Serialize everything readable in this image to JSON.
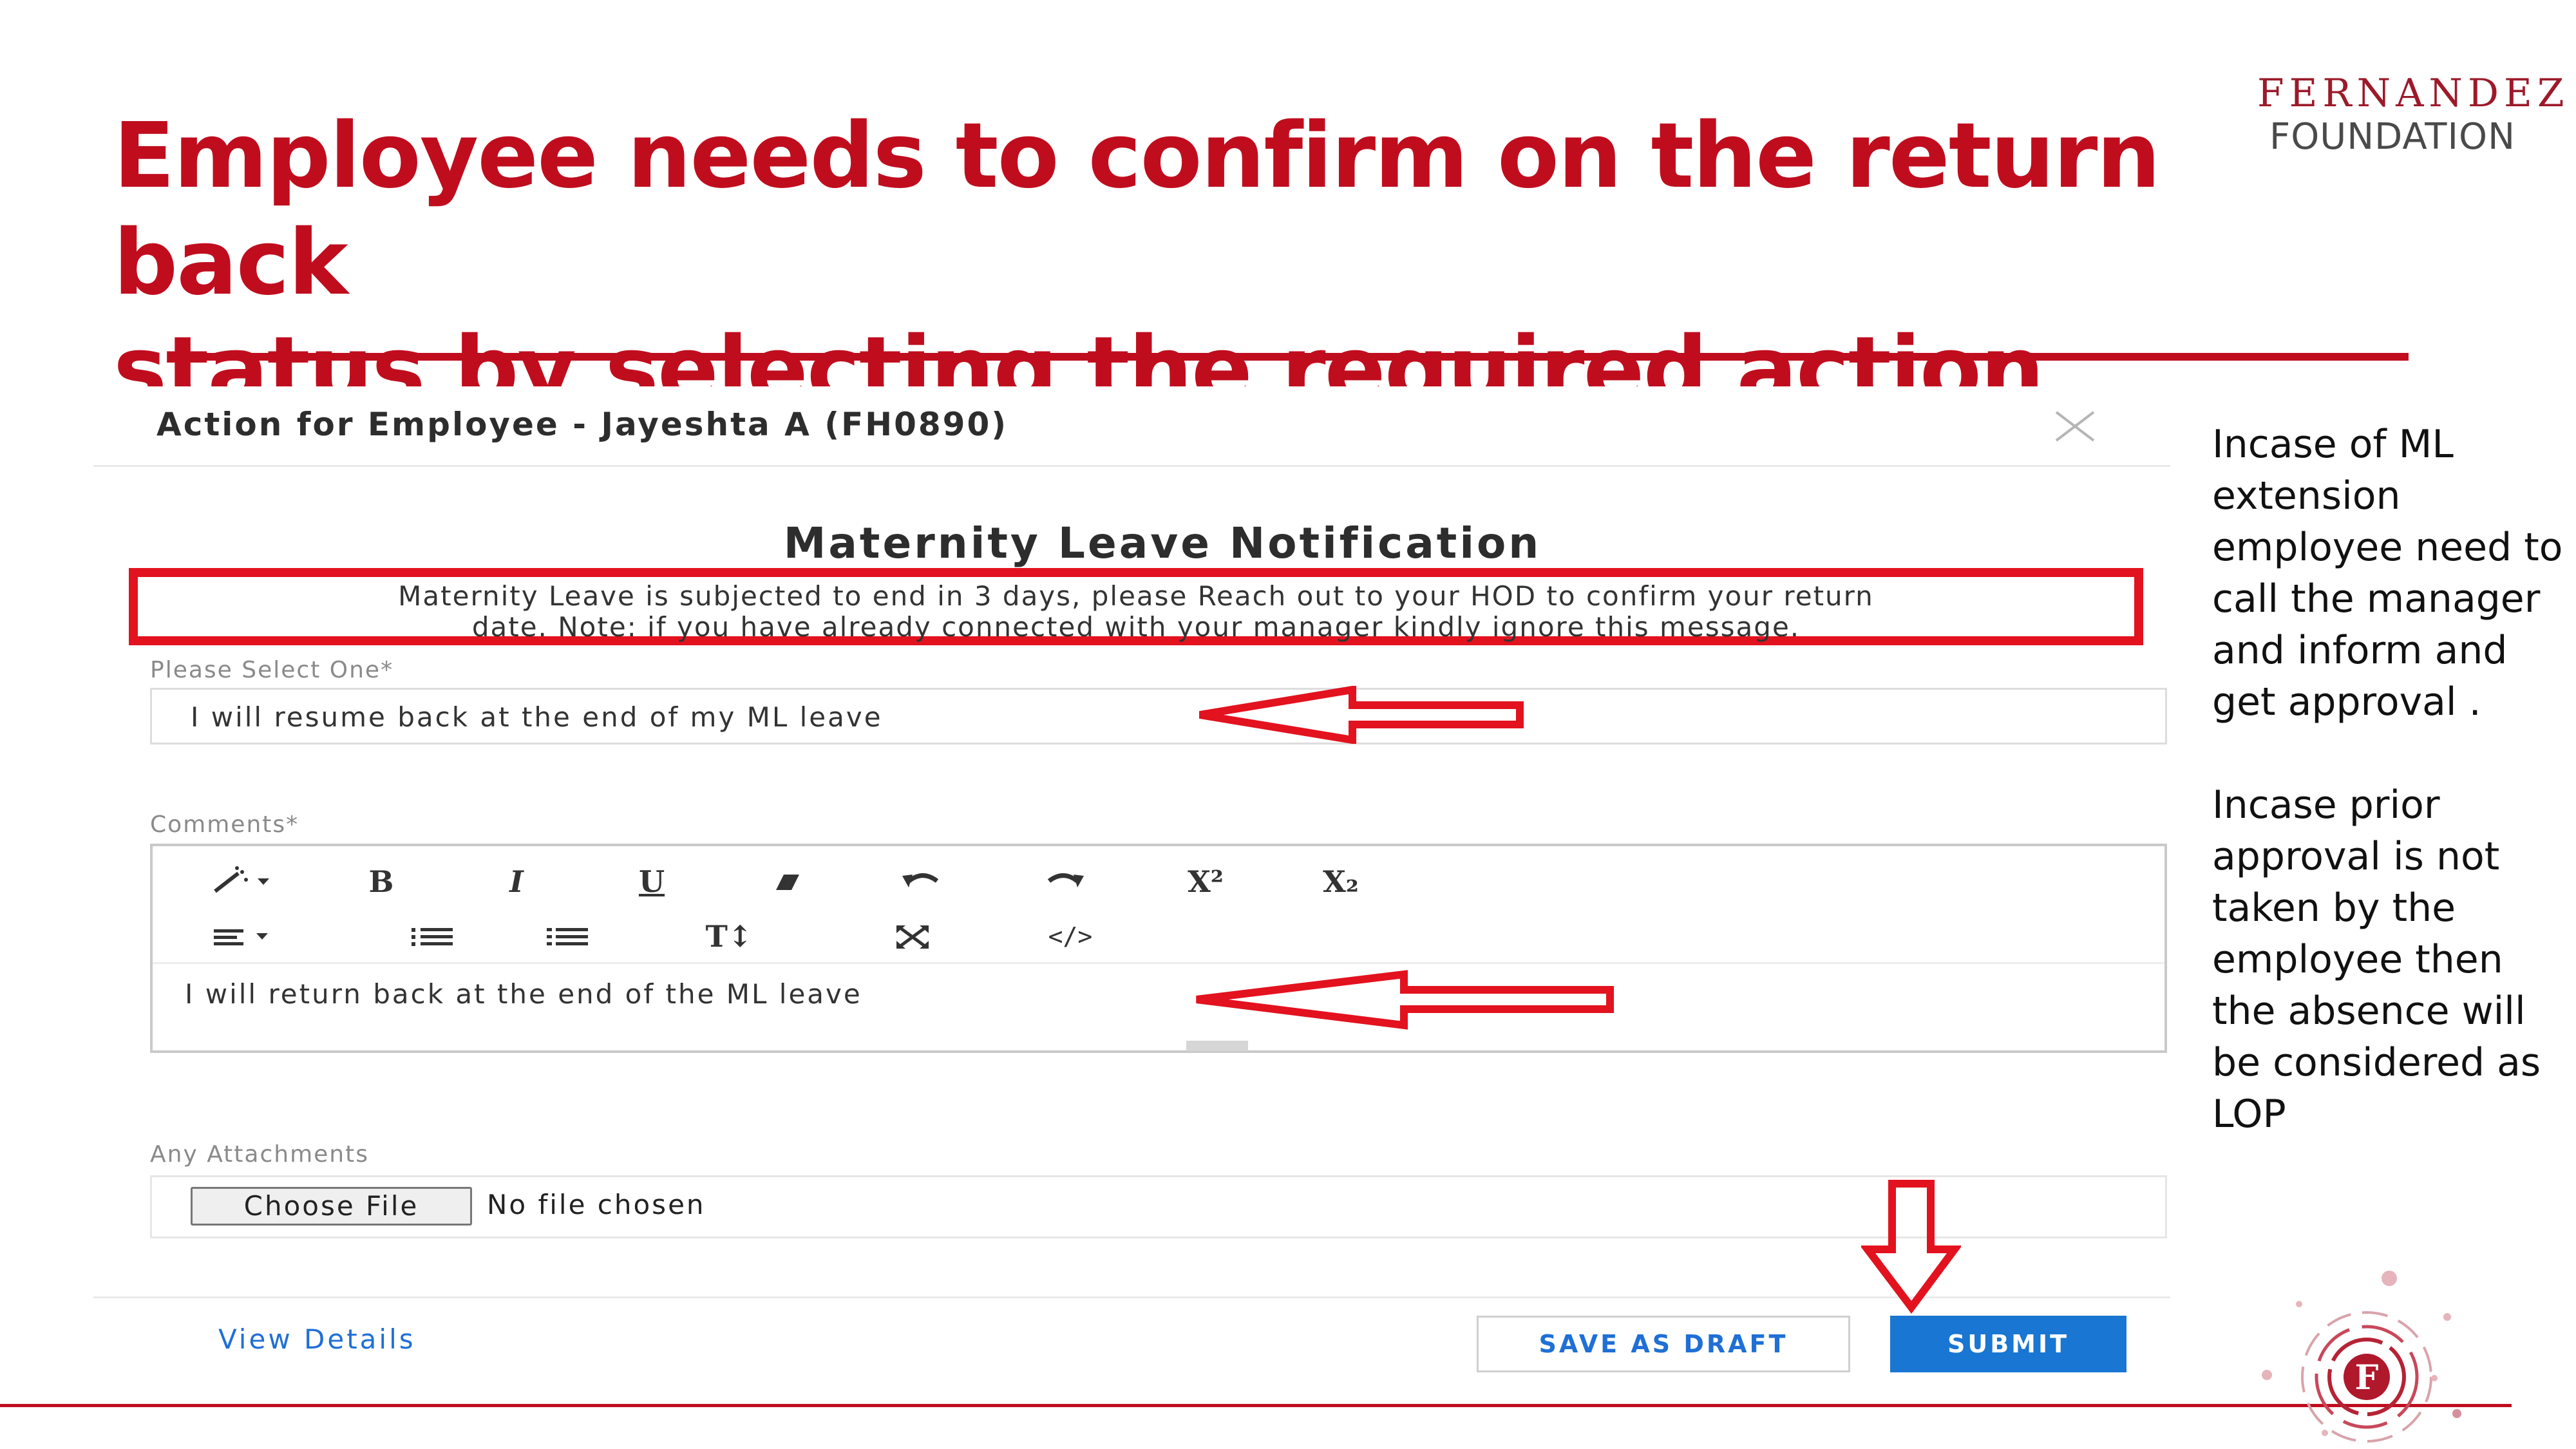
{
  "slide": {
    "title_line1": "Employee needs to confirm on the return back",
    "title_line2": "status by selecting the required action"
  },
  "logo": {
    "line1": "FERNANDEZ",
    "line2": "FOUNDATION",
    "emblem_letter": "F"
  },
  "modal": {
    "title": "Action for Employee - Jayeshta A (FH0890)",
    "notification_heading": "Maternity Leave Notification",
    "notification_line1": "Maternity Leave is subjected to end in 3 days, please Reach out to your HOD to confirm your return",
    "notification_line2": "date. Note: if you have already connected with your manager kindly ignore this message.",
    "select_label": "Please Select One*",
    "select_value": "I will resume back at the end of my ML leave",
    "comments_label": "Comments*",
    "toolbar": {
      "row1": [
        "magic-wand",
        "bold",
        "italic",
        "underline",
        "eraser",
        "undo",
        "redo",
        "superscript",
        "subscript"
      ],
      "row2": [
        "align",
        "unordered-list",
        "ordered-list",
        "font-size",
        "fullscreen",
        "code-view"
      ],
      "bold_label": "B",
      "italic_label": "I",
      "underline_label": "U",
      "superscript_label": "X²",
      "subscript_label": "X₂",
      "fontsize_label": "T↕",
      "code_label": "</>"
    },
    "comment_text": "I will return back at the end of the ML leave",
    "attachments_label": "Any Attachments",
    "choose_file_label": "Choose File",
    "file_status": "No file chosen",
    "view_details_label": "View Details",
    "save_draft_label": "SAVE AS DRAFT",
    "submit_label": "SUBMIT"
  },
  "side_note": {
    "paragraph1": "Incase of ML extension employee need to call the manager and inform and get approval .",
    "paragraph2": "Incase prior  approval is not taken by the employee then the absence will be considered as LOP"
  },
  "colors": {
    "title_red": "#c00d1e",
    "highlight_red": "#e3121f",
    "submit_blue": "#1976d2",
    "link_blue": "#1f6fd6"
  }
}
